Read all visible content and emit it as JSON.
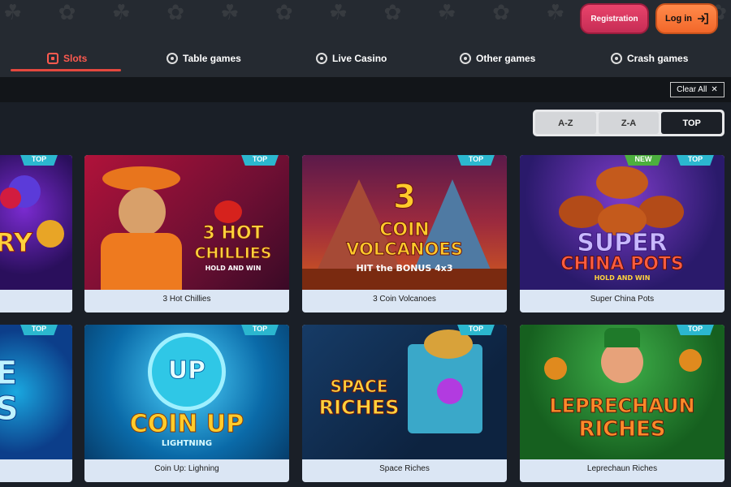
{
  "header": {
    "registration_label": "Registration",
    "login_label": "Log in"
  },
  "nav": {
    "tabs": [
      {
        "label": "Slots",
        "icon": "slot-machine-icon",
        "active": true
      },
      {
        "label": "Table games",
        "icon": "table-games-icon",
        "active": false
      },
      {
        "label": "Live Casino",
        "icon": "live-casino-icon",
        "active": false
      },
      {
        "label": "Other games",
        "icon": "other-games-icon",
        "active": false
      },
      {
        "label": "Crash games",
        "icon": "crash-games-icon",
        "active": false
      }
    ]
  },
  "filters": {
    "clear_all_label": "Clear All",
    "clear_icon": "close-icon"
  },
  "sort": {
    "options": [
      "A-Z",
      "Z-A",
      "TOP"
    ],
    "selected": "TOP"
  },
  "games": [
    {
      "name": "",
      "badges": [
        "TOP"
      ],
      "art": [
        "RY"
      ]
    },
    {
      "name": "3 Hot Chillies",
      "badges": [
        "TOP"
      ],
      "art": [
        "3 HOT",
        "CHILLIES",
        "HOLD AND WIN"
      ]
    },
    {
      "name": "3 Coin Volcanoes",
      "badges": [
        "TOP"
      ],
      "art": [
        "3",
        "COIN",
        "VOLCANOES",
        "HIT the BONUS 4x3"
      ]
    },
    {
      "name": "Super China Pots",
      "badges": [
        "NEW",
        "TOP"
      ],
      "art": [
        "SUPER",
        "CHINA POTS",
        "HOLD AND WIN"
      ]
    },
    {
      "name": "",
      "badges": [
        "TOP"
      ],
      "art": [
        "E",
        "S"
      ]
    },
    {
      "name": "Coin Up: Lighning",
      "badges": [
        "TOP"
      ],
      "art": [
        "UP",
        "COIN UP",
        "LIGHTNING"
      ]
    },
    {
      "name": "Space Riches",
      "badges": [
        "TOP"
      ],
      "art": [
        "SPACE",
        "RICHES"
      ]
    },
    {
      "name": "Leprechaun Riches",
      "badges": [
        "TOP"
      ],
      "art": [
        "LEPRECHAUN",
        "RICHES"
      ]
    }
  ],
  "colors": {
    "accent": "#e4483e",
    "registration": "#d6385f",
    "login": "#f2672a",
    "badge_top": "#2bb7cf",
    "badge_new": "#4caf3e"
  }
}
